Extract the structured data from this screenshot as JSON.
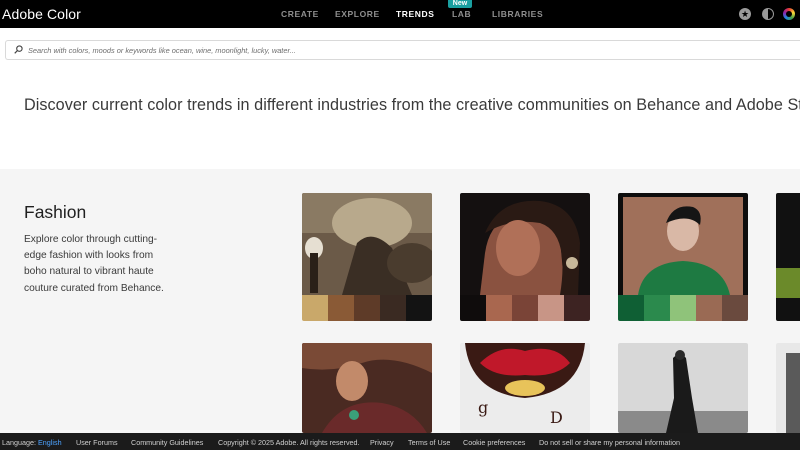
{
  "app": {
    "title": "Adobe Color"
  },
  "nav": {
    "items": [
      {
        "label": "CREATE",
        "active": false
      },
      {
        "label": "EXPLORE",
        "active": false
      },
      {
        "label": "TRENDS",
        "active": true
      },
      {
        "label": "LAB",
        "active": false,
        "badge": "New"
      },
      {
        "label": "LIBRARIES",
        "active": false
      }
    ]
  },
  "header_icons": [
    "star-icon",
    "theme-toggle-icon",
    "color-wheel-icon"
  ],
  "search": {
    "placeholder": "Search with colors, moods or keywords like ocean, wine, moonlight, lucky, water...",
    "value": ""
  },
  "headline": "Discover current color trends in different industries from the creative communities on Behance and Adobe Stock.",
  "section": {
    "title": "Fashion",
    "description": "Explore color through cutting-edge fashion with looks from boho natural to vibrant haute couture curated from Behance.",
    "cards_row1": [
      {
        "swatches": [
          "#c9a86a",
          "#8a5a36",
          "#5e3b28",
          "#3a2a22",
          "#131313"
        ]
      },
      {
        "swatches": [
          "#0f0c0c",
          "#a9674f",
          "#7a4437",
          "#c89586",
          "#3d2322"
        ]
      },
      {
        "swatches": [
          "#0f5f34",
          "#2b8a4d",
          "#8fc37a",
          "#9a6a54",
          "#6a4a3e"
        ]
      }
    ],
    "cards_row2": [
      {},
      {},
      {}
    ]
  },
  "footer": {
    "language_label": "Language:",
    "language_value": "English",
    "links": [
      "User Forums",
      "Community Guidelines",
      "Copyright © 2025 Adobe. All rights reserved.",
      "Privacy",
      "Terms of Use",
      "Cookie preferences",
      "Do not sell or share my personal information"
    ]
  },
  "colors": {
    "topbar": "#000000",
    "accent_badge": "#1a9fa0",
    "section_bg": "#f5f5f5",
    "footer_bg": "#1b1b1b",
    "language_link": "#4da3ff"
  }
}
